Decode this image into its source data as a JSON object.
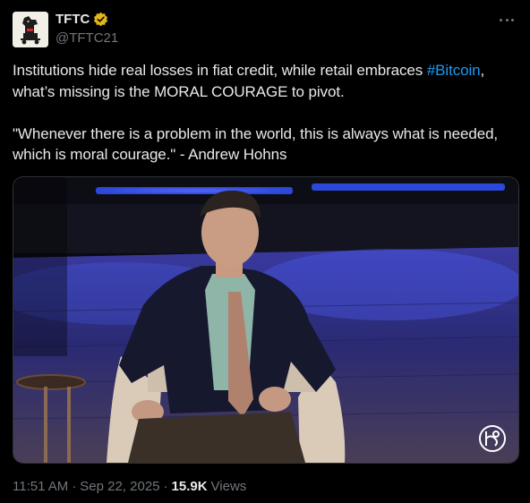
{
  "author": {
    "display_name": "TFTC",
    "handle": "@TFTC21",
    "avatar_icon": "trojan-horse-logo",
    "verified_badge_color": "#e2b719"
  },
  "tweet": {
    "line1_prefix": "Institutions hide real losses in fiat credit, while retail embraces ",
    "hashtag": "#Bitcoin",
    "line1_suffix": ",",
    "line2": "what’s missing is the MORAL COURAGE to pivot.",
    "quote_line1": "\"Whenever there is a problem in the world, this is always what is needed,",
    "quote_line2": "which is moral courage.\" - Andrew Hohns"
  },
  "media": {
    "description_icon": "video-still",
    "stage_light_color": "#3d6cff",
    "watermark_icon": "circle-monogram-icon"
  },
  "meta": {
    "time": "11:51 AM",
    "separator1": "·",
    "date": "Sep 22, 2025",
    "separator2": "·",
    "views_count": "15.9K",
    "views_label": "Views"
  },
  "colors": {
    "background": "#000000",
    "text": "#e7e9ea",
    "secondary": "#71767b",
    "link": "#1d9bf0"
  }
}
